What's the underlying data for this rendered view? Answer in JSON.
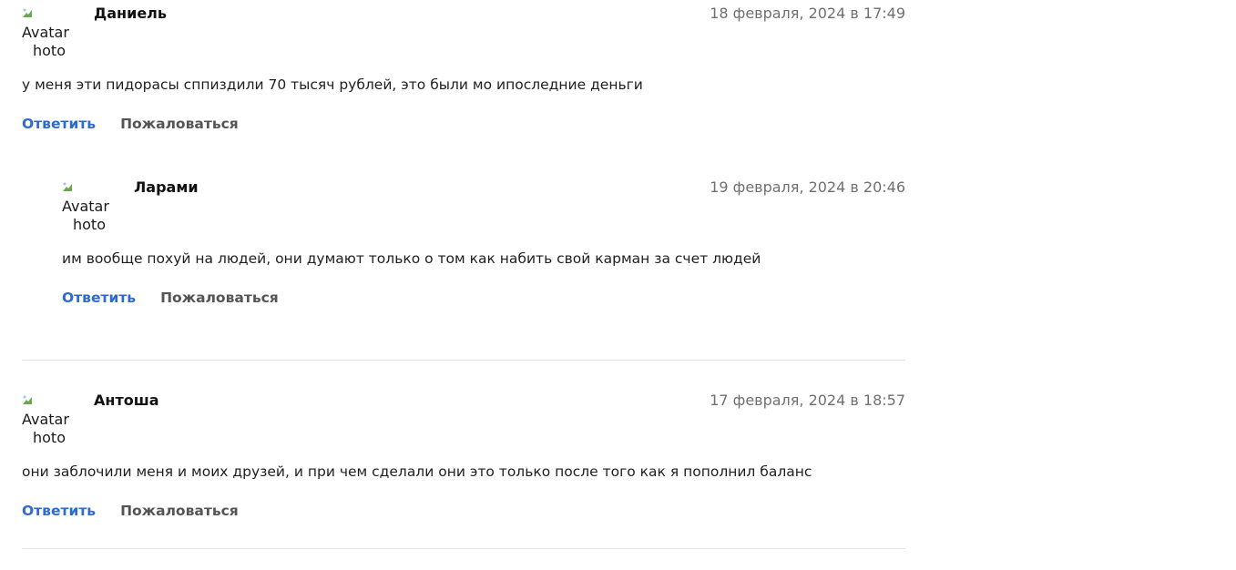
{
  "avatar_alt_line1": "Avatar",
  "avatar_alt_line2": "hoto",
  "actions": {
    "reply_label": "Ответить",
    "report_label": "Пожаловаться"
  },
  "comments": [
    {
      "author": "Даниель",
      "date": "18 февраля, 2024 в 17:49",
      "text": "у меня эти пидорасы сппиздили 70 тысяч рублей, это были мо ипоследние деньги",
      "replies": [
        {
          "author": "Ларами",
          "date": "19 февраля, 2024 в 20:46",
          "text": "им вообще похуй на людей, они думают только о том как набить свой карман за счет людей"
        }
      ]
    },
    {
      "author": "Антоша",
      "date": "17 февраля, 2024 в 18:57",
      "text": "они заблочили меня и моих друзей, и при чем сделали они это только после того как я пополнил баланс",
      "replies": []
    }
  ]
}
